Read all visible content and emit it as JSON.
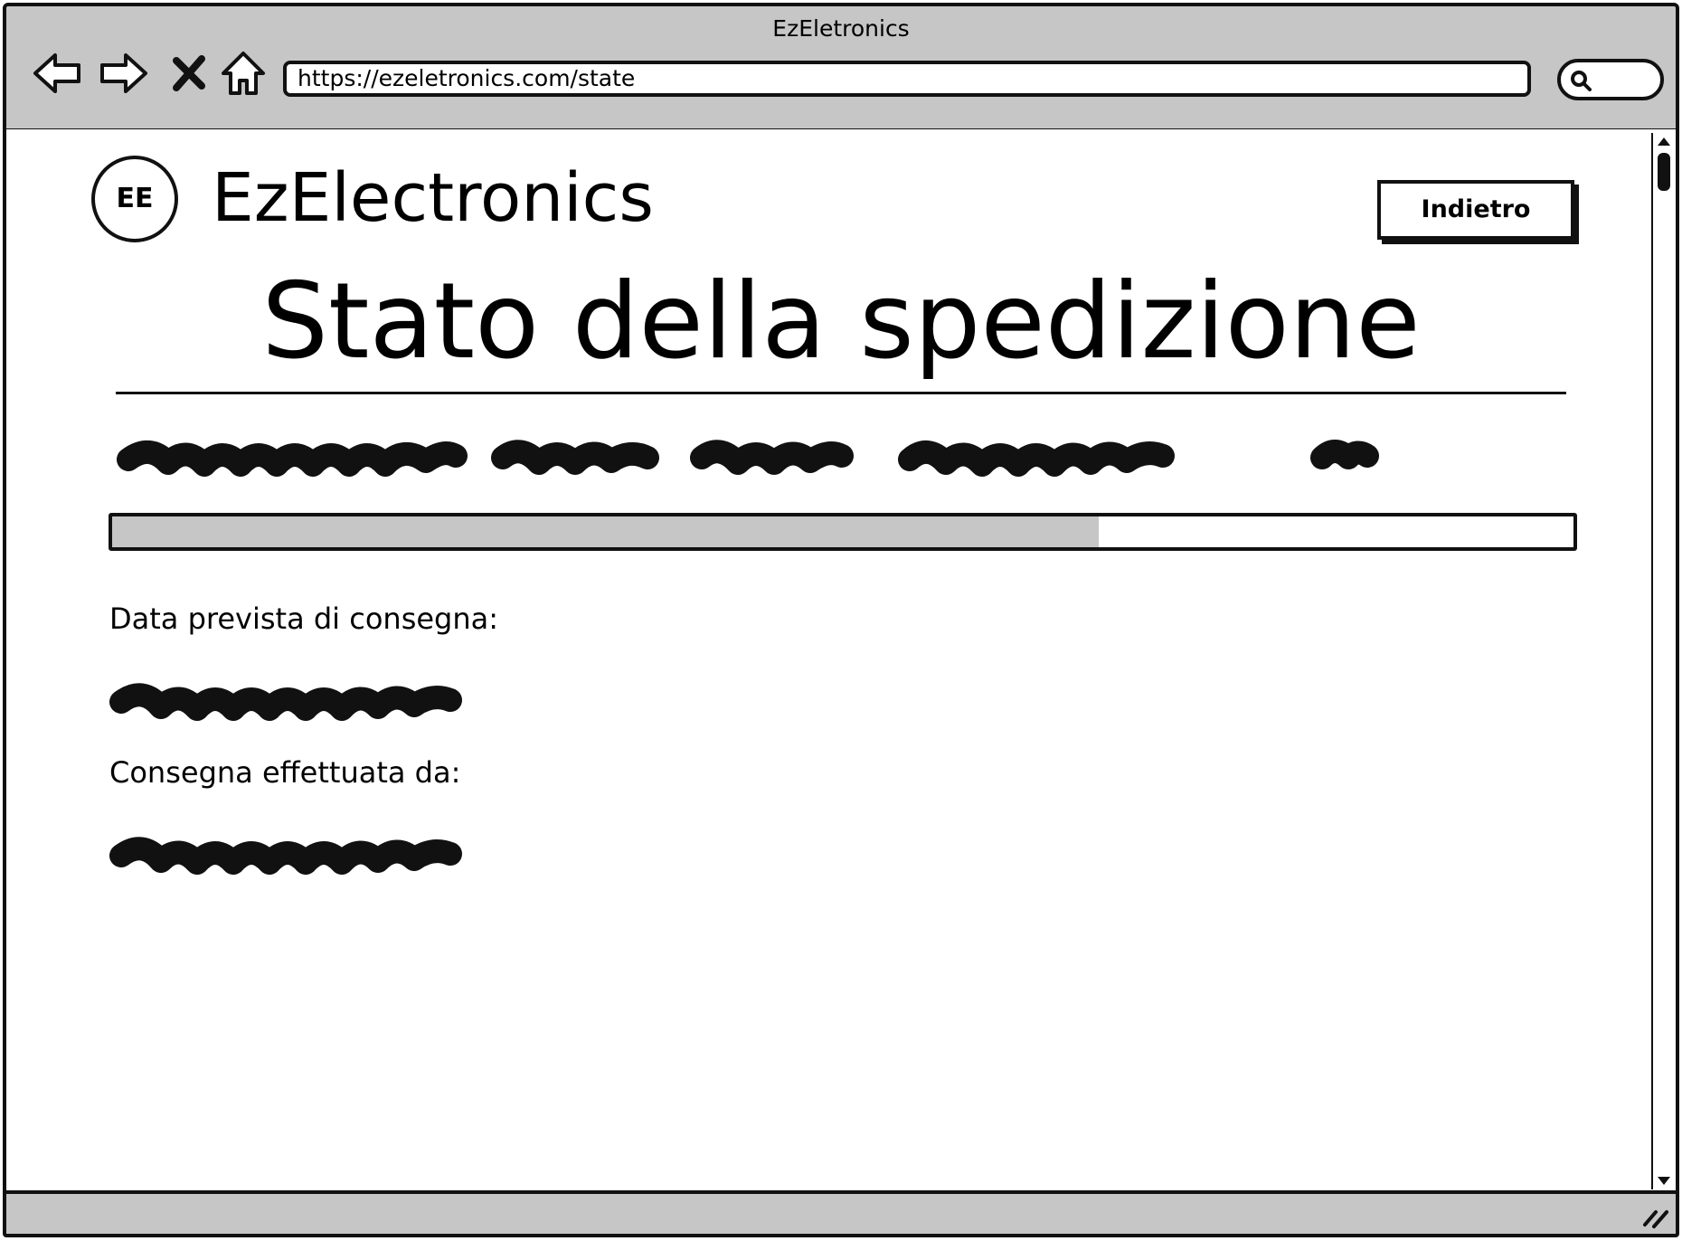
{
  "browser": {
    "window_title": "EzEletronics",
    "url": "https://ezeletronics.com/state"
  },
  "header": {
    "logo_text": "EE",
    "brand_name": "EzElectronics",
    "back_button_label": "Indietro"
  },
  "main": {
    "title": "Stato della spedizione",
    "progress": {
      "fraction": 0.675
    },
    "fields": [
      {
        "label": "Data prevista di consegna:"
      },
      {
        "label": "Consegna effettuata da:"
      }
    ]
  },
  "icons": {
    "nav": [
      "back-arrow-icon",
      "forward-arrow-icon",
      "close-icon",
      "home-icon"
    ],
    "search": "search-icon",
    "resize": "resize-grip-icon"
  },
  "colors": {
    "chrome": "#c6c6c6",
    "ink": "#111111",
    "progress_fill": "#c6c6c6"
  }
}
